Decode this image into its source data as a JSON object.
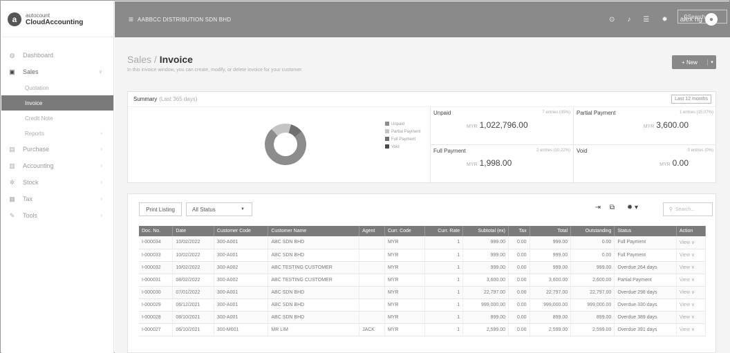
{
  "brand": {
    "line1": "autocount",
    "line2": "CloudAccounting",
    "logo_letter": "a"
  },
  "sidebar": {
    "items": [
      {
        "label": "Dashboard",
        "icon": "dashboard-icon"
      },
      {
        "label": "Sales",
        "icon": "sales-icon"
      },
      {
        "label": "Purchase",
        "icon": "purchase-icon"
      },
      {
        "label": "Accounting",
        "icon": "accounting-icon"
      },
      {
        "label": "Stock",
        "icon": "stock-icon"
      },
      {
        "label": "Tax",
        "icon": "tax-icon"
      },
      {
        "label": "Tools",
        "icon": "tools-icon"
      }
    ],
    "sales_sub": [
      "Quotation",
      "Invoice",
      "Credit Note",
      "Reports"
    ]
  },
  "topbar": {
    "company": "AABBCC DISTRIBUTION SDN BHD",
    "search": "Search...",
    "user": "alex ng"
  },
  "page": {
    "title_prefix": "Sales / ",
    "title": "Invoice",
    "subtitle": "In this invoice window, you can create, modify, or delete invoice for your customer.",
    "new_label": "+ New"
  },
  "summary": {
    "title": "Summary",
    "range": "(Last 365 days)",
    "range_button": "Last 12 months",
    "legend": [
      "Unpaid",
      "Partial Payment",
      "Full Payment",
      "Void"
    ],
    "unpaid": {
      "name": "Unpaid",
      "pct": "7 entries (35%)",
      "currency": "MYR",
      "amount": "1,022,796.00"
    },
    "partial": {
      "name": "Partial Payment",
      "pct": "1 entries (15.07%)",
      "currency": "MYR",
      "amount": "3,600.00"
    },
    "full": {
      "name": "Full Payment",
      "pct": "2 entries (10.22%)",
      "currency": "MYR",
      "amount": "1,998.00"
    },
    "void": {
      "name": "Void",
      "pct": "0 entries (0%)",
      "currency": "MYR",
      "amount": "0.00"
    }
  },
  "colors": {
    "unpaid": "#8c8c8c",
    "partial": "#c4c4c4",
    "full": "#6f6f6f",
    "void": "#4a4a4a"
  },
  "list": {
    "print_label": "Print Listing",
    "status_filter": "All Status",
    "search_placeholder": "Search...",
    "columns": [
      "Doc. No.",
      "Date",
      "Customer Code",
      "Customer Name",
      "Agent",
      "Curr. Code",
      "Curr. Rate",
      "Subtotal (ex)",
      "Tax",
      "Total",
      "Outstanding",
      "Status",
      "Action"
    ],
    "rows": [
      [
        "I-000034",
        "10/02/2022",
        "300-A001",
        "ABC SDN BHD",
        "",
        "MYR",
        "1",
        "999.00",
        "0.00",
        "999.00",
        "0.00",
        "Full Payment",
        "View"
      ],
      [
        "I-000033",
        "10/02/2022",
        "300-A001",
        "ABC SDN BHD",
        "",
        "MYR",
        "1",
        "999.00",
        "0.00",
        "999.00",
        "0.00",
        "Full Payment",
        "View"
      ],
      [
        "I-000032",
        "10/02/2022",
        "300-A002",
        "ABC TESTING CUSTOMER",
        "",
        "MYR",
        "1",
        "999.00",
        "0.00",
        "999.00",
        "999.00",
        "Overdue 264 days",
        "View"
      ],
      [
        "I-000031",
        "08/02/2022",
        "300-A002",
        "ABC TESTING CUSTOMER",
        "",
        "MYR",
        "1",
        "3,600.00",
        "0.00",
        "3,600.00",
        "2,600.00",
        "Partial Payment",
        "View"
      ],
      [
        "I-000030",
        "07/01/2022",
        "300-A001",
        "ABC SDN BHD",
        "",
        "MYR",
        "1",
        "22,797.00",
        "0.00",
        "22,797.00",
        "22,797.00",
        "Overdue 298 days",
        "View"
      ],
      [
        "I-000029",
        "06/12/2021",
        "300-A001",
        "ABC SDN BHD",
        "",
        "MYR",
        "1",
        "999,000.00",
        "0.00",
        "999,000.00",
        "999,000.00",
        "Overdue 330 days",
        "View"
      ],
      [
        "I-000028",
        "08/10/2021",
        "300-A001",
        "ABC SDN BHD",
        "",
        "MYR",
        "1",
        "899.00",
        "0.00",
        "899.00",
        "899.00",
        "Overdue 389 days",
        "View"
      ],
      [
        "I-000027",
        "06/10/2021",
        "300-M001",
        "MR LIM",
        "JACK",
        "MYR",
        "1",
        "2,599.00",
        "0.00",
        "2,599.00",
        "2,599.00",
        "Overdue 391 days",
        "View"
      ]
    ]
  }
}
